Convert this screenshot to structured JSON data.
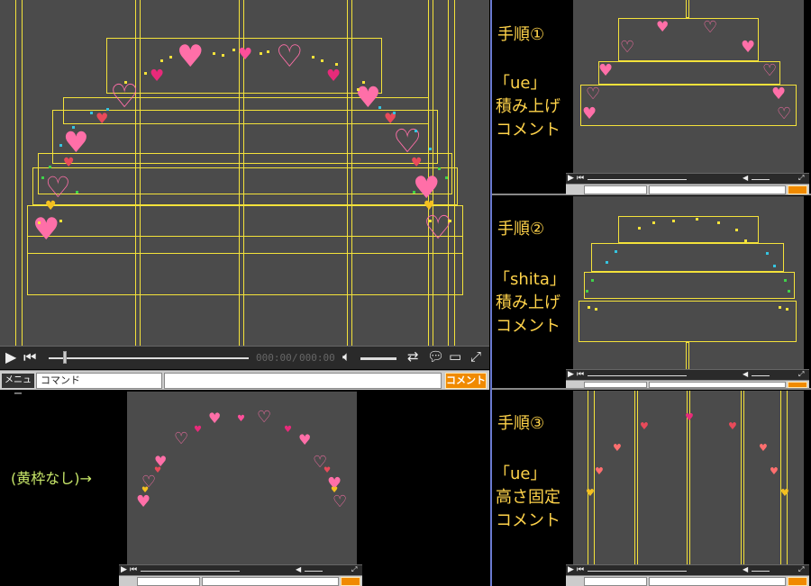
{
  "main_player": {
    "time_current": "000:00",
    "time_separator": "/",
    "time_total": "000:00",
    "menu_label": "メニュー",
    "command_value": "コマンド",
    "comment_button": "コメント"
  },
  "bottom_preview": {
    "note": "(黄枠なし)→"
  },
  "steps": [
    {
      "title": "手順①",
      "cmd": "「ue」",
      "desc1": "積み上げ",
      "desc2": "コメント"
    },
    {
      "title": "手順②",
      "cmd": "「shita」",
      "desc1": "積み上げ",
      "desc2": "コメント"
    },
    {
      "title": "手順③",
      "cmd": "「ue」",
      "desc1": "高さ固定",
      "desc2": "コメント"
    }
  ],
  "colors": {
    "frame": "#f4e23a",
    "screen_bg": "#4b4b4b",
    "heart_pink": "#ff6fa8",
    "heart_red": "#e84a5a",
    "dot_yellow": "#f4e23a",
    "dot_cyan": "#35c4e0",
    "dot_green": "#3fd34a",
    "comment_button": "#f08a00",
    "divider": "#6b7bd2"
  }
}
